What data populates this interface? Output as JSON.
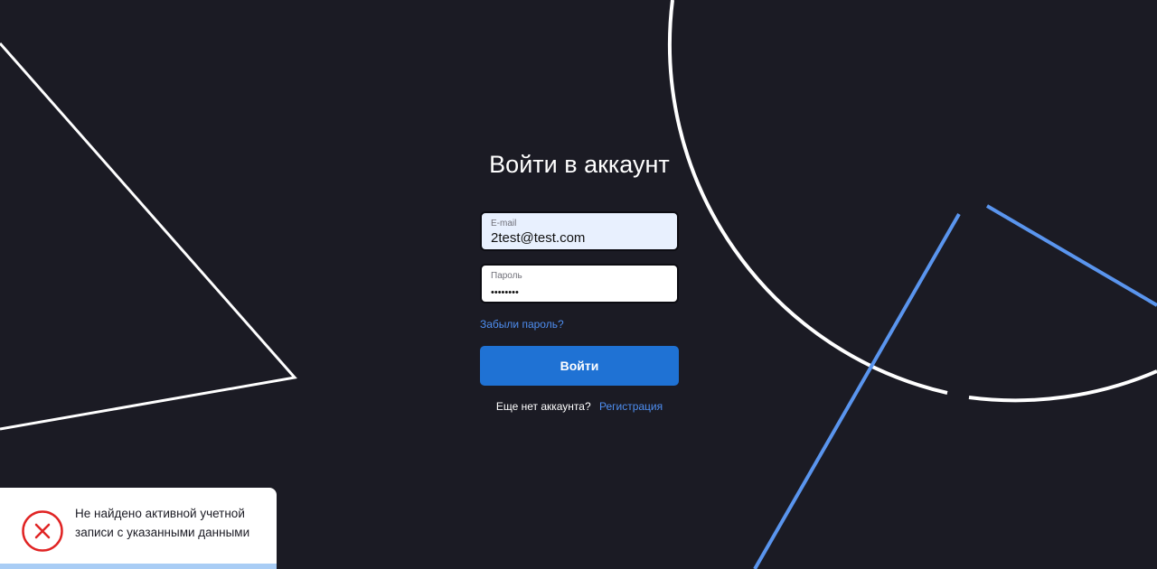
{
  "login": {
    "title": "Войти в аккаунт",
    "email_label": "E-mail",
    "email_value": "2test@test.com",
    "password_label": "Пароль",
    "password_value": "••••••••",
    "forgot_link": "Забыли пароль?",
    "submit_label": "Войти",
    "no_account_text": "Еще нет аккаунта?",
    "register_link": "Регистрация"
  },
  "toast": {
    "type": "error",
    "icon": "error-x-circle-icon",
    "message": "Не найдено активной учетной записи с указанными данными",
    "progress": 1.0
  },
  "colors": {
    "background": "#1b1b24",
    "accent": "#1f72d4",
    "link": "#4e8ef0",
    "decor_blue": "#5a95ee",
    "decor_white": "#ffffff",
    "error": "#e02424",
    "toast_progress": "#a9cdf5"
  }
}
